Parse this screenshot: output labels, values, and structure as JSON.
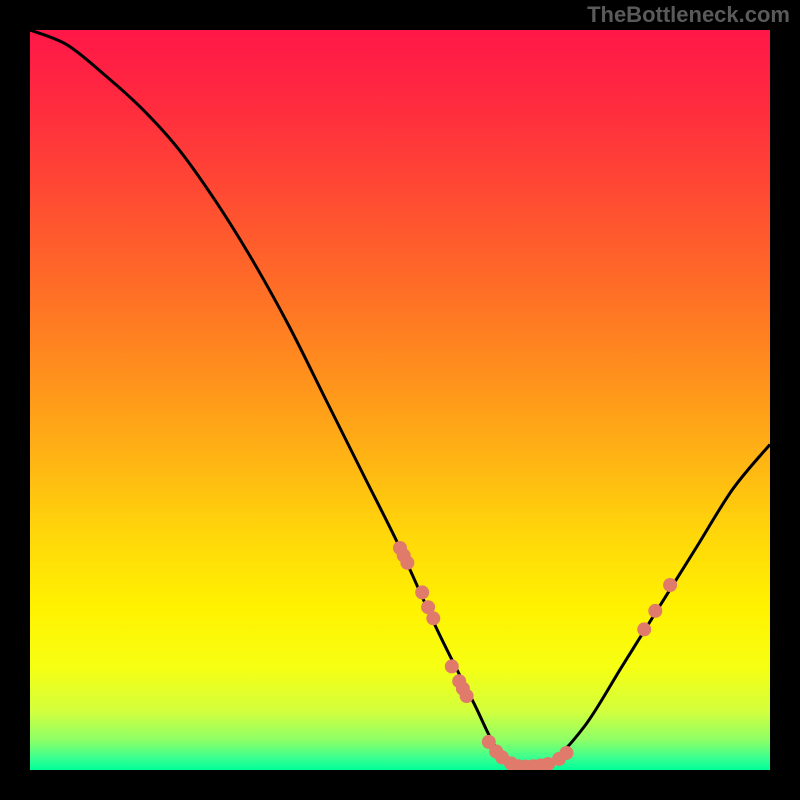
{
  "watermark": "TheBottleneck.com",
  "chart_data": {
    "type": "line",
    "title": "",
    "xlabel": "",
    "ylabel": "",
    "xlim": [
      0,
      100
    ],
    "ylim": [
      0,
      100
    ],
    "curve": {
      "name": "bottleneck-curve",
      "x": [
        0,
        5,
        10,
        15,
        20,
        25,
        30,
        35,
        40,
        45,
        50,
        55,
        60,
        63,
        66,
        70,
        75,
        80,
        85,
        90,
        95,
        100
      ],
      "y": [
        100,
        98,
        94,
        89.5,
        84,
        77,
        69,
        60,
        50,
        40,
        30,
        19,
        9,
        3,
        0.5,
        0.8,
        6,
        14,
        22,
        30,
        38,
        44
      ]
    },
    "markers": {
      "name": "data-points",
      "color": "#e07a6b",
      "points": [
        {
          "x": 50.0,
          "y": 30.0
        },
        {
          "x": 50.5,
          "y": 29.0
        },
        {
          "x": 51.0,
          "y": 28.0
        },
        {
          "x": 53.0,
          "y": 24.0
        },
        {
          "x": 53.8,
          "y": 22.0
        },
        {
          "x": 54.5,
          "y": 20.5
        },
        {
          "x": 57.0,
          "y": 14.0
        },
        {
          "x": 58.0,
          "y": 12.0
        },
        {
          "x": 58.5,
          "y": 11.0
        },
        {
          "x": 59.0,
          "y": 10.0
        },
        {
          "x": 62.0,
          "y": 3.8
        },
        {
          "x": 63.0,
          "y": 2.5
        },
        {
          "x": 63.8,
          "y": 1.7
        },
        {
          "x": 65.0,
          "y": 0.9
        },
        {
          "x": 66.0,
          "y": 0.5
        },
        {
          "x": 67.0,
          "y": 0.45
        },
        {
          "x": 68.0,
          "y": 0.5
        },
        {
          "x": 69.0,
          "y": 0.6
        },
        {
          "x": 70.0,
          "y": 0.8
        },
        {
          "x": 71.5,
          "y": 1.5
        },
        {
          "x": 72.5,
          "y": 2.3
        },
        {
          "x": 83.0,
          "y": 19.0
        },
        {
          "x": 84.5,
          "y": 21.5
        },
        {
          "x": 86.5,
          "y": 25.0
        }
      ]
    },
    "gradient_stops": [
      {
        "offset": 0.0,
        "color": "#ff1748"
      },
      {
        "offset": 0.1,
        "color": "#ff2b3f"
      },
      {
        "offset": 0.22,
        "color": "#ff4a33"
      },
      {
        "offset": 0.34,
        "color": "#ff6b27"
      },
      {
        "offset": 0.46,
        "color": "#ff8e1d"
      },
      {
        "offset": 0.58,
        "color": "#ffb414"
      },
      {
        "offset": 0.68,
        "color": "#ffd60a"
      },
      {
        "offset": 0.78,
        "color": "#fff200"
      },
      {
        "offset": 0.86,
        "color": "#f7ff12"
      },
      {
        "offset": 0.92,
        "color": "#d3ff3c"
      },
      {
        "offset": 0.96,
        "color": "#8cff68"
      },
      {
        "offset": 0.985,
        "color": "#35ff91"
      },
      {
        "offset": 1.0,
        "color": "#00ff99"
      }
    ]
  }
}
